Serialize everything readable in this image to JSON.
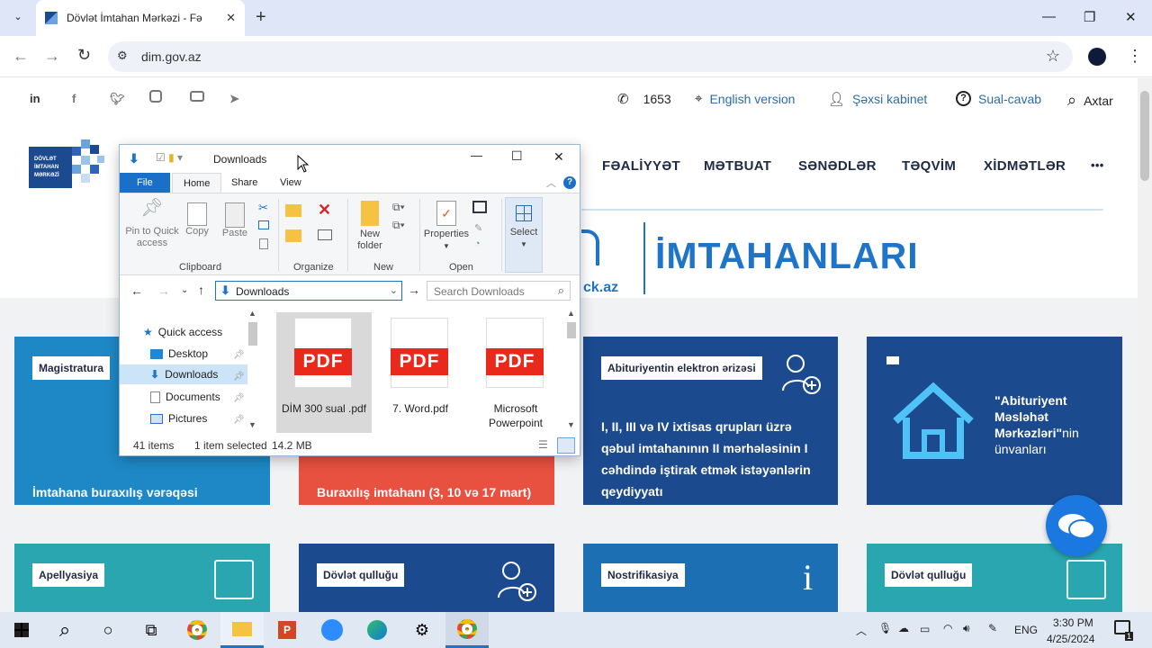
{
  "browser": {
    "tab_title": "Dövlət İmtahan Mərkəzi - Fəaliyy",
    "url": "dim.gov.az",
    "window_controls": {
      "minimize": "—",
      "restore": "❐",
      "close": "✕"
    }
  },
  "site": {
    "social": [
      "in",
      "f",
      "t",
      "ig",
      "yt",
      "tg"
    ],
    "phone": "1653",
    "links": [
      "English version",
      "Şəxsi kabinet",
      "Sual-cavab",
      "Axtar"
    ],
    "logo_text": [
      "DÖVLƏT",
      "İMTAHAN",
      "MƏRKƏZİ"
    ],
    "nav": [
      "FƏALİYYƏT",
      "MƏTBUAT",
      "SƏNƏDLƏR",
      "TƏQVİM",
      "XİDMƏTLƏR",
      "•••"
    ],
    "banner_text": "İMTAHANLARI",
    "banner_domain": "ck.az",
    "cards_row1": [
      {
        "label": "Magistratura",
        "bottom": "İmtahana buraxılış vərəqəsi",
        "color": "#1e88c6"
      },
      {
        "label": "",
        "bottom": "Buraxılış imtahanı (3, 10 və 17 mart)",
        "color": "#e8503f"
      },
      {
        "label": "Abituriyentin elektron ərizəsi",
        "body": "I, II, III və IV ixtisas qrupları üzrə qəbul imtahanının II mərhələsinin I cəhdində iştirak etmək istəyənlərin qeydiyyatı",
        "color": "#1c4a8f"
      },
      {
        "label": "",
        "title_bold": "\"Abituriyent Məsləhət Mərkəzləri\"",
        "title_rest": "nin ünvanları",
        "color": "#1c4a8f"
      }
    ],
    "cards_row2": [
      {
        "label": "Apellyasiya",
        "color": "#2aa6b0"
      },
      {
        "label": "Dövlət qulluğu",
        "color": "#1c4a8f"
      },
      {
        "label": "Nostrifikasiya",
        "color": "#1c6fb3"
      },
      {
        "label": "Dövlət qulluğu",
        "color": "#2aa6b0"
      }
    ]
  },
  "explorer": {
    "title": "Downloads",
    "ribbon_tabs": [
      "File",
      "Home",
      "Share",
      "View"
    ],
    "buttons": {
      "pin": "Pin to Quick access",
      "copy": "Copy",
      "paste": "Paste",
      "new_folder": "New folder",
      "properties": "Properties",
      "select": "Select"
    },
    "groups": [
      "Clipboard",
      "Organize",
      "New",
      "Open"
    ],
    "address": "Downloads",
    "search_placeholder": "Search Downloads",
    "nav_items": [
      "Quick access",
      "Desktop",
      "Downloads",
      "Documents",
      "Pictures"
    ],
    "files": [
      {
        "name": "DİM 300 sual .pdf",
        "icon": "PDF",
        "selected": true
      },
      {
        "name": "7. Word.pdf",
        "icon": "PDF",
        "selected": false
      },
      {
        "name": "Microsoft Powerpoint",
        "icon": "PDF",
        "selected": false
      }
    ],
    "status": {
      "items": "41 items",
      "selected": "1 item selected",
      "size": "14.2 MB"
    }
  },
  "taskbar": {
    "lang": "ENG",
    "time": "3:30 PM",
    "date": "4/25/2024",
    "notification_count": "1"
  }
}
